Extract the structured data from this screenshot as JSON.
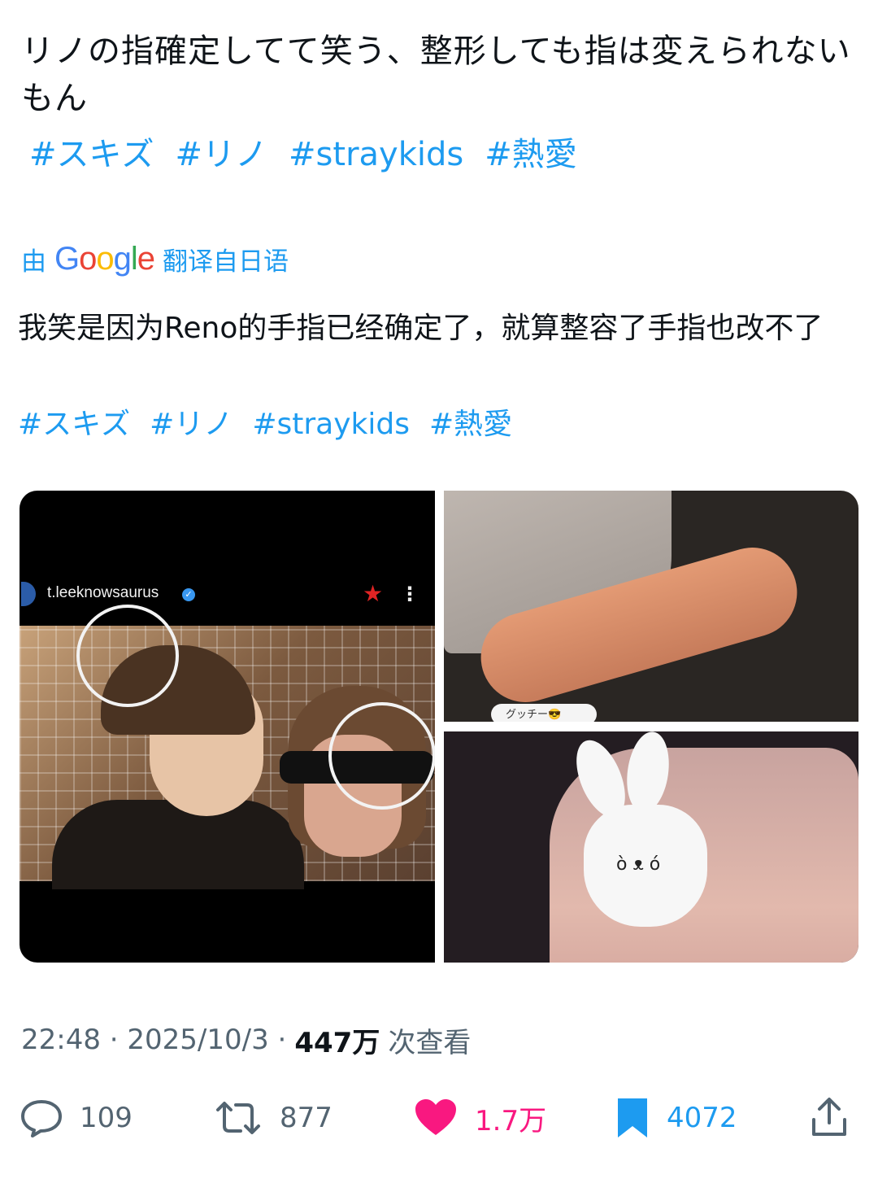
{
  "tweet": {
    "original_text": "リノの指確定してて笑う、整形しても指は変えられないもん",
    "hashtags": [
      "#スキズ",
      "#リノ",
      "#straykids",
      "#熱愛"
    ],
    "translation_prefix": "由",
    "translation_brand": "Google",
    "translation_suffix": "翻译自日语",
    "translated_text": "我笑是因为Reno的手指已经确定了，就算整容了手指也改不了",
    "translated_hashtags": [
      "#スキズ",
      "#リノ",
      "#straykids",
      "#熱愛"
    ],
    "timestamp": "22:48 · 2025/10/3 ·",
    "views_count": "447万",
    "views_label": "次查看"
  },
  "media": {
    "image1": {
      "username": "t.leeknowsaurus",
      "verified_icon": "verified-badge-icon",
      "star_icon": "star-icon",
      "more_icon": "more-vertical-icon"
    },
    "image2": {
      "chip_label": "グッチー😎"
    }
  },
  "actions": {
    "reply": {
      "icon": "reply-icon",
      "count": "109"
    },
    "retweet": {
      "icon": "retweet-icon",
      "count": "877"
    },
    "like": {
      "icon": "heart-icon",
      "count": "1.7万",
      "color": "#f91880"
    },
    "bookmark": {
      "icon": "bookmark-icon",
      "count": "4072",
      "color": "#1d9bf0"
    },
    "share": {
      "icon": "share-icon"
    }
  },
  "colors": {
    "link": "#1d9bf0",
    "text": "#0f1419",
    "secondary": "#536471"
  }
}
